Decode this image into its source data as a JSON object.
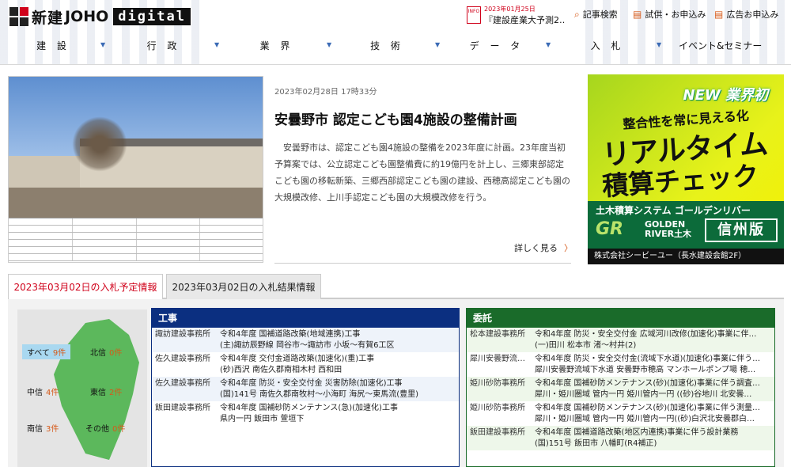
{
  "header": {
    "logo_jp": "新建",
    "logo_en": "JOHO",
    "logo_digital": "digital",
    "info": {
      "tag": "INFO",
      "date": "2023年01月25日",
      "text": "『建設産業大予測2…"
    },
    "buttons": [
      {
        "label": "記事検索",
        "icon": "search-icon"
      },
      {
        "label": "試供・お申込み",
        "icon": "document-icon"
      },
      {
        "label": "広告お申込み",
        "icon": "document-icon"
      }
    ],
    "nav": [
      "建 設",
      "行 政",
      "業 界",
      "技 術",
      "デ ー タ",
      "入 札",
      "イベント&セミナー"
    ]
  },
  "article": {
    "date": "2023年02月28日 17時33分",
    "title": "安曇野市 認定こども園4施設の整備計画",
    "body": "安曇野市は、認定こども園4施設の整備を2023年度に計画。23年度当初予算案では、公立認定こども園整備費に約19億円を計上し、三郷東部認定こども園の移転新築、三郷西部認定こども園の建設、西穂高認定こども園の大規模改修、上川手認定こども園の大規模改修を行う。",
    "more": "詳しく見る"
  },
  "ad": {
    "badge": "NEW 業界初",
    "sub": "整合性を常に見える化",
    "main1": "リアルタイム",
    "main2": "積算チェック",
    "system": "土木積算システム ゴールデンリバー",
    "gr": "GR",
    "golden": "GOLDEN\nRIVER土木",
    "shinshu": "信州版",
    "company": "株式会社シービーユー（長水建設会館2F）"
  },
  "tabs": [
    {
      "label": "2023年03月02日の入札予定情報",
      "active": true
    },
    {
      "label": "2023年03月02日の入札結果情報",
      "active": false
    }
  ],
  "map": {
    "regions": [
      {
        "name": "すべて",
        "count": "9件"
      },
      {
        "name": "北信",
        "count": "0件"
      },
      {
        "name": "中信",
        "count": "4件"
      },
      {
        "name": "東信",
        "count": "2件"
      },
      {
        "name": "南信",
        "count": "3件"
      },
      {
        "name": "その他",
        "count": "0件"
      }
    ]
  },
  "koji": {
    "title": "工事",
    "color": "#0b2f80",
    "rows": [
      {
        "org": "諏訪建設事務所",
        "l1": "令和4年度 国補道路改築(地域連携)工事",
        "l2": "(主)諏訪辰野線 岡谷市～諏訪市 小坂～有賀6工区"
      },
      {
        "org": "佐久建設事務所",
        "l1": "令和4年度 交付金道路改築(加速化)(重)工事",
        "l2": "(砂)西沢 南佐久郡南相木村 西和田"
      },
      {
        "org": "佐久建設事務所",
        "l1": "令和4年度 防災・安全交付金 災害防除(加速化)工事",
        "l2": "(国)141号 南佐久郡南牧村～小海町 海尻～東馬流(豊里)"
      },
      {
        "org": "飯田建設事務所",
        "l1": "令和4年度 国補砂防メンテナンス(急)(加速化)工事",
        "l2": "県内一円 飯田市 萱垣下"
      }
    ]
  },
  "itaku": {
    "title": "委託",
    "color": "#1a6b2a",
    "rows": [
      {
        "org": "松本建設事務所",
        "l1": "令和4年度 防災・安全交付金 広域河川改修(加速化)事業に伴…",
        "l2": "(一)田川 松本市 渚～村井(2)"
      },
      {
        "org": "犀川安曇野流…",
        "l1": "令和4年度 防災・安全交付金(流域下水道)(加速化)事業に伴う…",
        "l2": "犀川安曇野流域下水道 安曇野市穂高 マンホールポンプ場 穂…"
      },
      {
        "org": "姫川砂防事務所",
        "l1": "令和4年度 国補砂防メンテナンス(砂)(加速化)事業に伴う調査…",
        "l2": "犀川・姫川圏域 管内一円 姫川管内一円 ((砂)谷地川 北安曇…"
      },
      {
        "org": "姫川砂防事務所",
        "l1": "令和4年度 国補砂防メンテナンス(砂)(加速化)事業に伴う測量…",
        "l2": "犀川・姫川圏域 管内一円 姫川管内一円((砂)白沢北安曇郡白…"
      },
      {
        "org": "飯田建設事務所",
        "l1": "令和4年度 国補道路改築(地区内連携)事業に伴う設計業務",
        "l2": "(国)151号 飯田市 八幡町(R4補正)"
      }
    ]
  }
}
